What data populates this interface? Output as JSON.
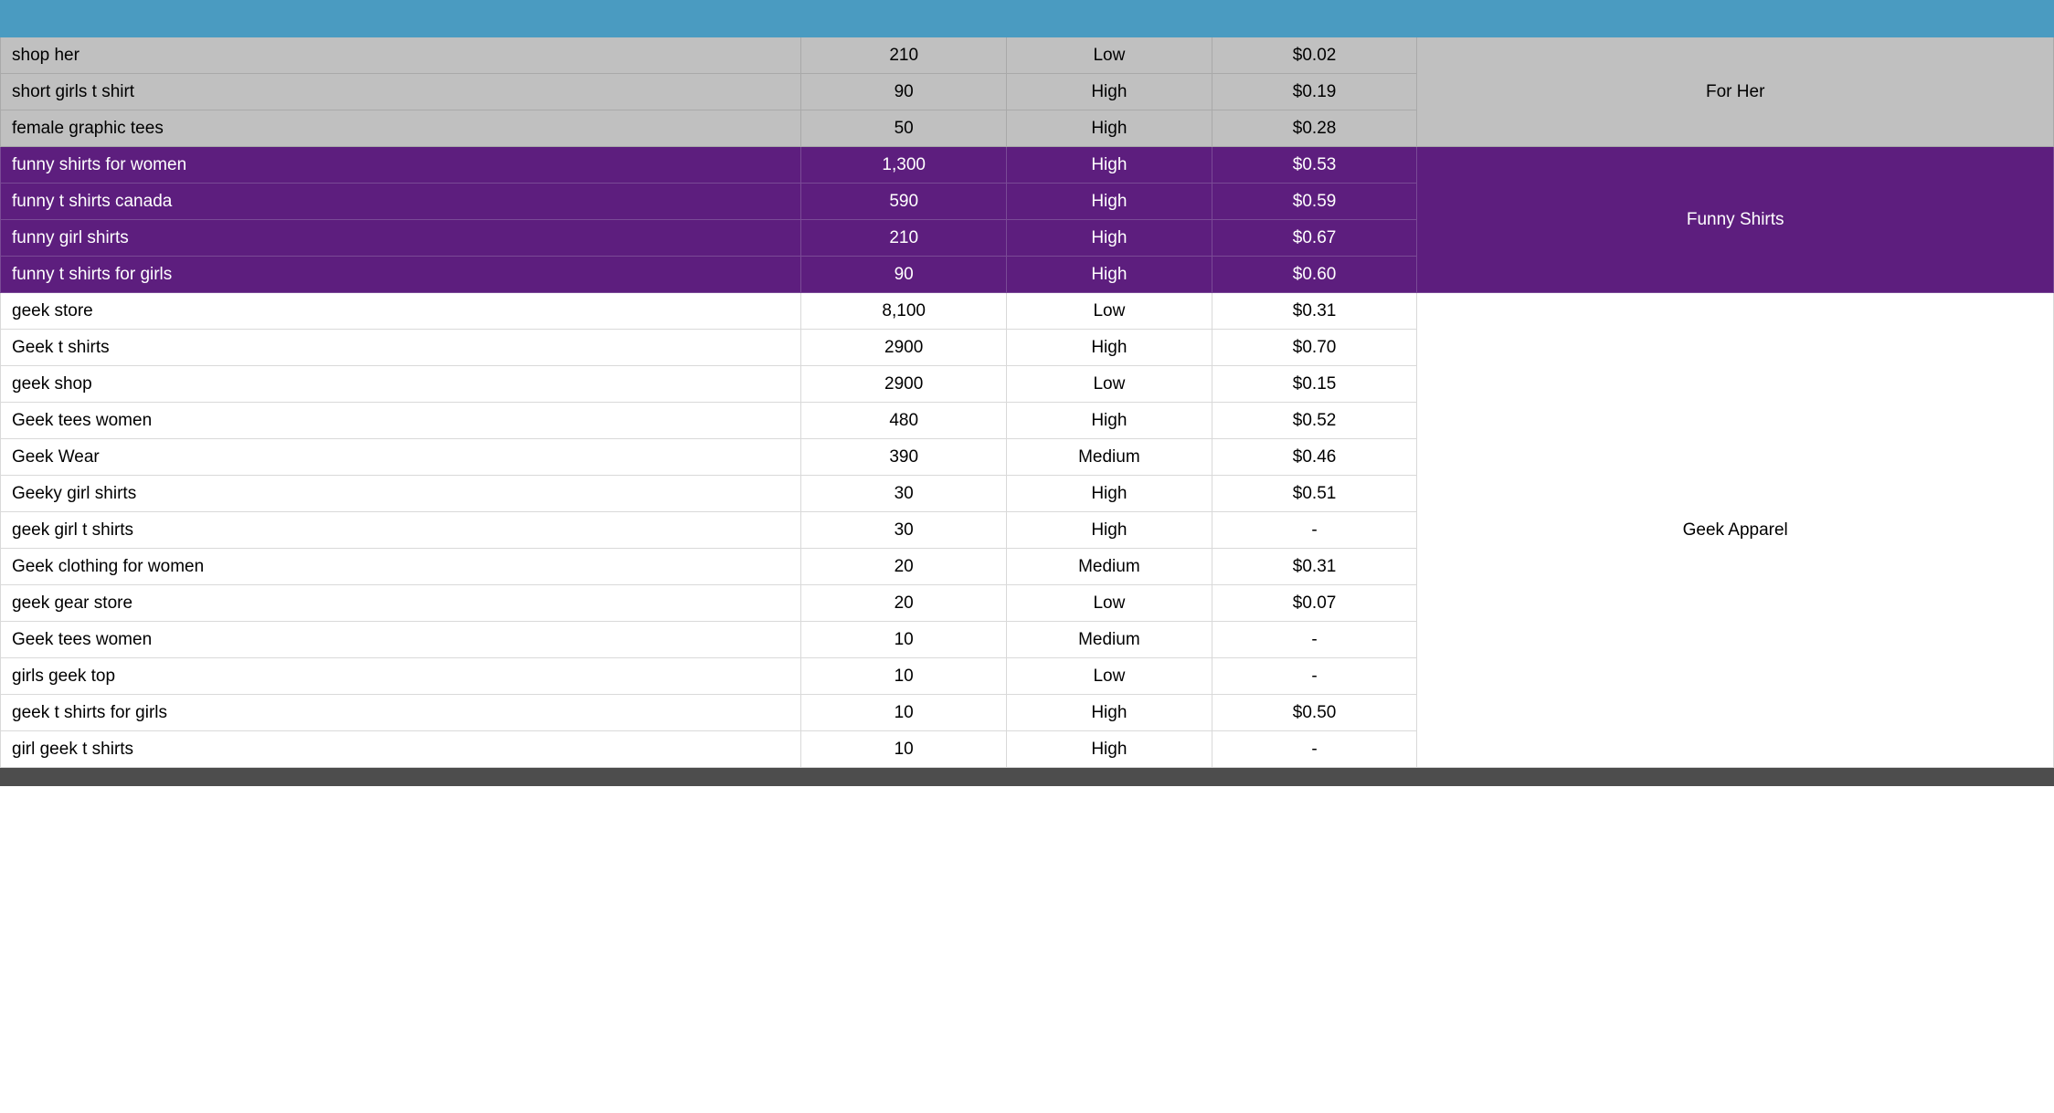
{
  "header": {
    "keyword": "",
    "volume": "",
    "competition": "",
    "cpc": ""
  },
  "groups": [
    {
      "class": "group-forher",
      "catClass": "cat-forher",
      "category": "For Her",
      "rows": [
        {
          "keyword": "shop her",
          "volume": "210",
          "competition": "Low",
          "cpc": "$0.02"
        },
        {
          "keyword": "short girls t shirt",
          "volume": "90",
          "competition": "High",
          "cpc": "$0.19"
        },
        {
          "keyword": "female graphic tees",
          "volume": "50",
          "competition": "High",
          "cpc": "$0.28"
        }
      ]
    },
    {
      "class": "group-funny",
      "catClass": "cat-funny",
      "category": "Funny Shirts",
      "rows": [
        {
          "keyword": "funny shirts for women",
          "volume": "1,300",
          "competition": "High",
          "cpc": "$0.53"
        },
        {
          "keyword": "funny t shirts canada",
          "volume": "590",
          "competition": "High",
          "cpc": "$0.59"
        },
        {
          "keyword": "funny girl shirts",
          "volume": "210",
          "competition": "High",
          "cpc": "$0.67"
        },
        {
          "keyword": "funny t shirts for girls",
          "volume": "90",
          "competition": "High",
          "cpc": "$0.60"
        }
      ]
    },
    {
      "class": "group-geek",
      "catClass": "cat-geek",
      "category": "Geek Apparel",
      "rows": [
        {
          "keyword": "geek store",
          "volume": "8,100",
          "competition": "Low",
          "cpc": "$0.31"
        },
        {
          "keyword": "Geek t shirts",
          "volume": "2900",
          "competition": "High",
          "cpc": "$0.70"
        },
        {
          "keyword": "geek shop",
          "volume": "2900",
          "competition": "Low",
          "cpc": "$0.15"
        },
        {
          "keyword": "Geek tees women",
          "volume": "480",
          "competition": "High",
          "cpc": "$0.52"
        },
        {
          "keyword": "Geek Wear",
          "volume": "390",
          "competition": "Medium",
          "cpc": "$0.46"
        },
        {
          "keyword": "Geeky girl shirts",
          "volume": "30",
          "competition": "High",
          "cpc": "$0.51"
        },
        {
          "keyword": "geek girl t shirts",
          "volume": "30",
          "competition": "High",
          "cpc": "-"
        },
        {
          "keyword": "Geek clothing for women",
          "volume": "20",
          "competition": "Medium",
          "cpc": "$0.31"
        },
        {
          "keyword": "geek gear store",
          "volume": "20",
          "competition": "Low",
          "cpc": "$0.07"
        },
        {
          "keyword": "Geek tees women",
          "volume": "10",
          "competition": "Medium",
          "cpc": "-"
        },
        {
          "keyword": "girls geek top",
          "volume": "10",
          "competition": "Low",
          "cpc": "-"
        },
        {
          "keyword": "geek t shirts for girls",
          "volume": "10",
          "competition": "High",
          "cpc": "$0.50"
        },
        {
          "keyword": "girl geek t shirts",
          "volume": "10",
          "competition": "High",
          "cpc": "-"
        }
      ]
    }
  ],
  "bottom": {
    "keyword": "",
    "volume": "",
    "competition": "",
    "cpc": ""
  }
}
